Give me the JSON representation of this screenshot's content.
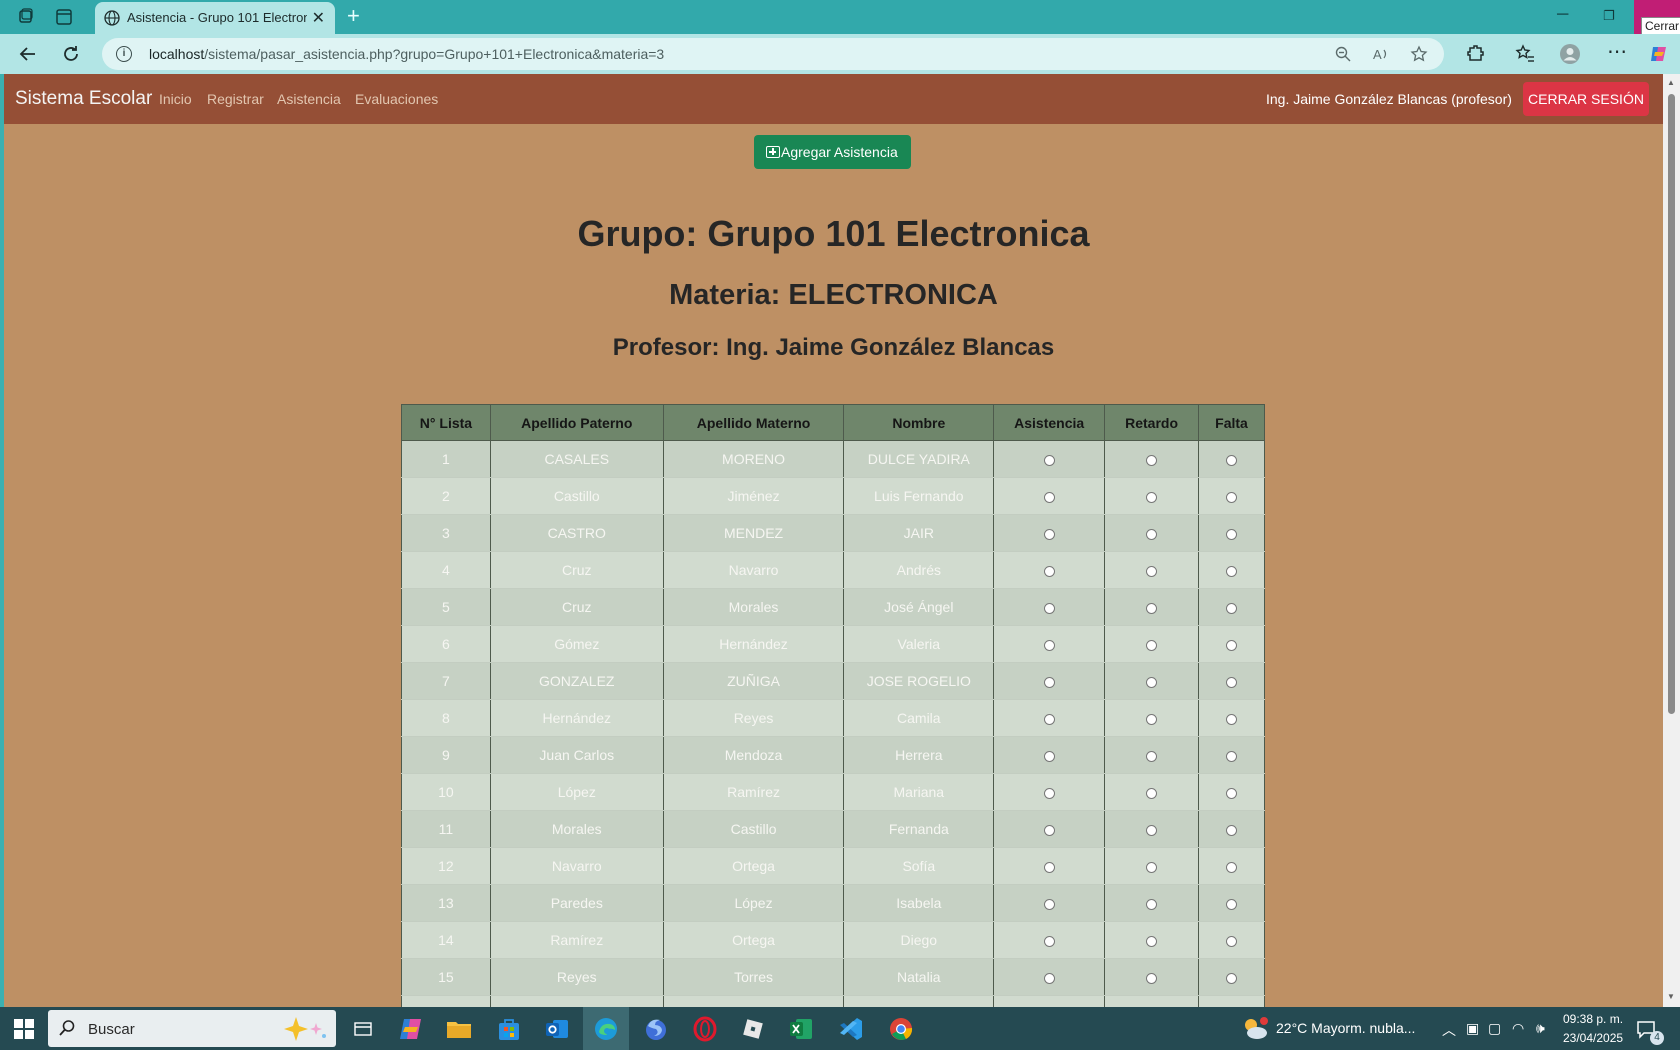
{
  "browser": {
    "tab_title": "Asistencia - Grupo 101 Electronica",
    "tab_close": "✕",
    "new_tab": "+",
    "url_host": "localhost",
    "url_path": "/sistema/pasar_asistencia.php?grupo=Grupo+101+Electronica&materia=3",
    "tooltip": "Cerrar"
  },
  "navbar": {
    "brand": "Sistema Escolar",
    "links": [
      "Inicio",
      "Registrar",
      "Asistencia",
      "Evaluaciones"
    ],
    "user": "Ing. Jaime González Blancas (profesor)",
    "logout": "CERRAR SESIÓN"
  },
  "page": {
    "add_button": "Agregar Asistencia",
    "grupo_title": "Grupo: Grupo 101 Electronica",
    "materia_title": "Materia: ELECTRONICA",
    "profesor_title": "Profesor: Ing. Jaime González Blancas"
  },
  "table": {
    "headers": [
      "N° Lista",
      "Apellido Paterno",
      "Apellido Materno",
      "Nombre",
      "Asistencia",
      "Retardo",
      "Falta"
    ],
    "rows": [
      [
        "1",
        "CASALES",
        "MORENO",
        "DULCE YADIRA"
      ],
      [
        "2",
        "Castillo",
        "Jiménez",
        "Luis Fernando"
      ],
      [
        "3",
        "CASTRO",
        "MENDEZ",
        "JAIR"
      ],
      [
        "4",
        "Cruz",
        "Navarro",
        "Andrés"
      ],
      [
        "5",
        "Cruz",
        "Morales",
        "José Ángel"
      ],
      [
        "6",
        "Gómez",
        "Hernández",
        "Valeria"
      ],
      [
        "7",
        "GONZALEZ",
        "ZUÑIGA",
        "JOSE ROGELIO"
      ],
      [
        "8",
        "Hernández",
        "Reyes",
        "Camila"
      ],
      [
        "9",
        "Juan Carlos",
        "Mendoza",
        "Herrera"
      ],
      [
        "10",
        "López",
        "Ramírez",
        "Mariana"
      ],
      [
        "11",
        "Morales",
        "Castillo",
        "Fernanda"
      ],
      [
        "12",
        "Navarro",
        "Ortega",
        "Sofía"
      ],
      [
        "13",
        "Paredes",
        "López",
        "Isabela"
      ],
      [
        "14",
        "Ramírez",
        "Ortega",
        "Diego"
      ],
      [
        "15",
        "Reyes",
        "Torres",
        "Natalia"
      ],
      [
        "",
        "",
        "",
        ""
      ]
    ]
  },
  "taskbar": {
    "search_placeholder": "Buscar",
    "weather": "22°C  Mayorm. nubla...",
    "time": "09:38 p. m.",
    "date": "23/04/2025",
    "notification_count": "4"
  },
  "colors": {
    "navbar": "#954f36",
    "page_bg": "#be9064",
    "header_row": "#6f866b",
    "logout": "#dc3545",
    "add_button": "#198754"
  }
}
